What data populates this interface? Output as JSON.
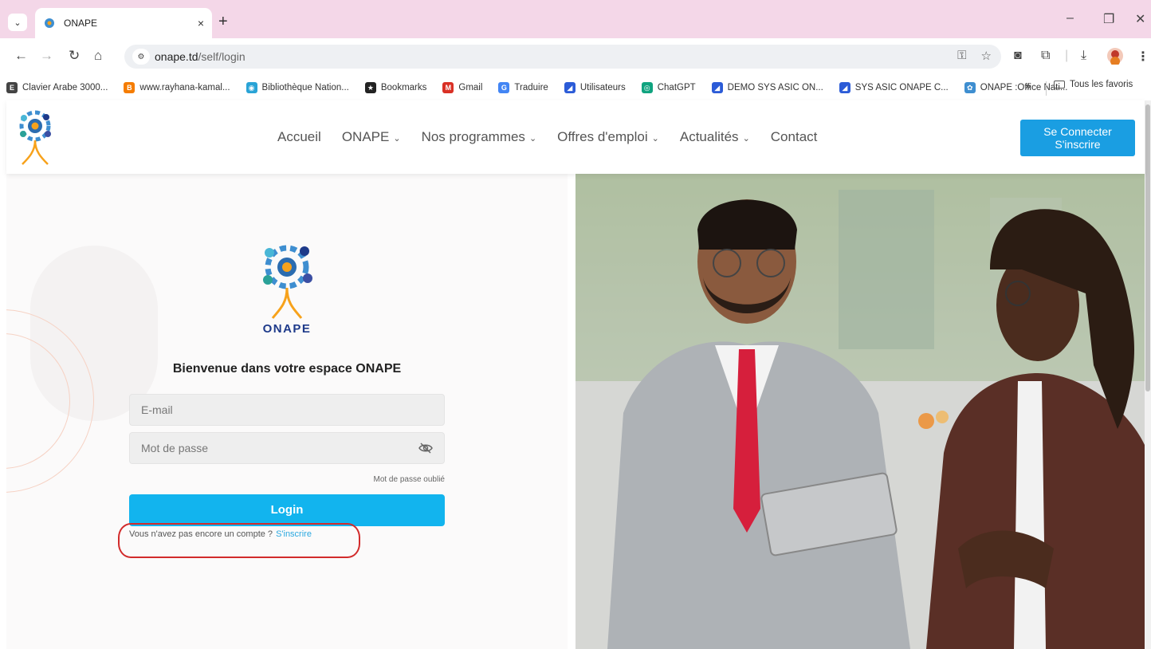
{
  "browser": {
    "tab_title": "ONAPE",
    "tab_close": "×",
    "new_tab": "+",
    "url_host": "onape.td",
    "url_path": "/self/login",
    "window_minimize": "–",
    "window_maximize": "❐",
    "window_close": "✕",
    "bookmarks": [
      {
        "label": "Clavier Arabe 3000...",
        "icon_color": "#444444",
        "glyph": "E"
      },
      {
        "label": "www.rayhana-kamal...",
        "icon_color": "#f57c00",
        "glyph": "B"
      },
      {
        "label": "Bibliothèque Nation...",
        "icon_color": "#29a3d6",
        "glyph": "◉"
      },
      {
        "label": "Bookmarks",
        "icon_color": "#222222",
        "glyph": "★"
      },
      {
        "label": "Gmail",
        "icon_color": "#d93025",
        "glyph": "M"
      },
      {
        "label": "Traduire",
        "icon_color": "#4285f4",
        "glyph": "G"
      },
      {
        "label": "Utilisateurs",
        "icon_color": "#2b5bd7",
        "glyph": "◢"
      },
      {
        "label": "ChatGPT",
        "icon_color": "#10a37f",
        "glyph": "◎"
      },
      {
        "label": "DEMO SYS ASIC ON...",
        "icon_color": "#2b5bd7",
        "glyph": "◢"
      },
      {
        "label": "SYS ASIC ONAPE C...",
        "icon_color": "#2b5bd7",
        "glyph": "◢"
      },
      {
        "label": "ONAPE :Office Nati...",
        "icon_color": "#3e8ed0",
        "glyph": "✿"
      }
    ],
    "bookmarks_more": "»",
    "all_bookmarks": "Tous les favoris"
  },
  "site": {
    "nav": [
      {
        "label": "Accueil",
        "has_menu": false
      },
      {
        "label": "ONAPE",
        "has_menu": true
      },
      {
        "label": "Nos programmes",
        "has_menu": true
      },
      {
        "label": "Offres d'emploi",
        "has_menu": true
      },
      {
        "label": "Actualités",
        "has_menu": true
      },
      {
        "label": "Contact",
        "has_menu": false
      }
    ],
    "connect_line1": "Se Connecter",
    "connect_line2": "S'inscrire",
    "brand_color": "#1a9ee2"
  },
  "login": {
    "logo_text": "ONAPE",
    "welcome": "Bienvenue dans votre espace ONAPE",
    "email_placeholder": "E-mail",
    "password_placeholder": "Mot de passe",
    "forgot": "Mot de passe oublié",
    "submit": "Login",
    "no_account": "Vous n'avez pas encore un compte ?",
    "signup_link": "S'inscrire",
    "button_color": "#12b4ee"
  }
}
